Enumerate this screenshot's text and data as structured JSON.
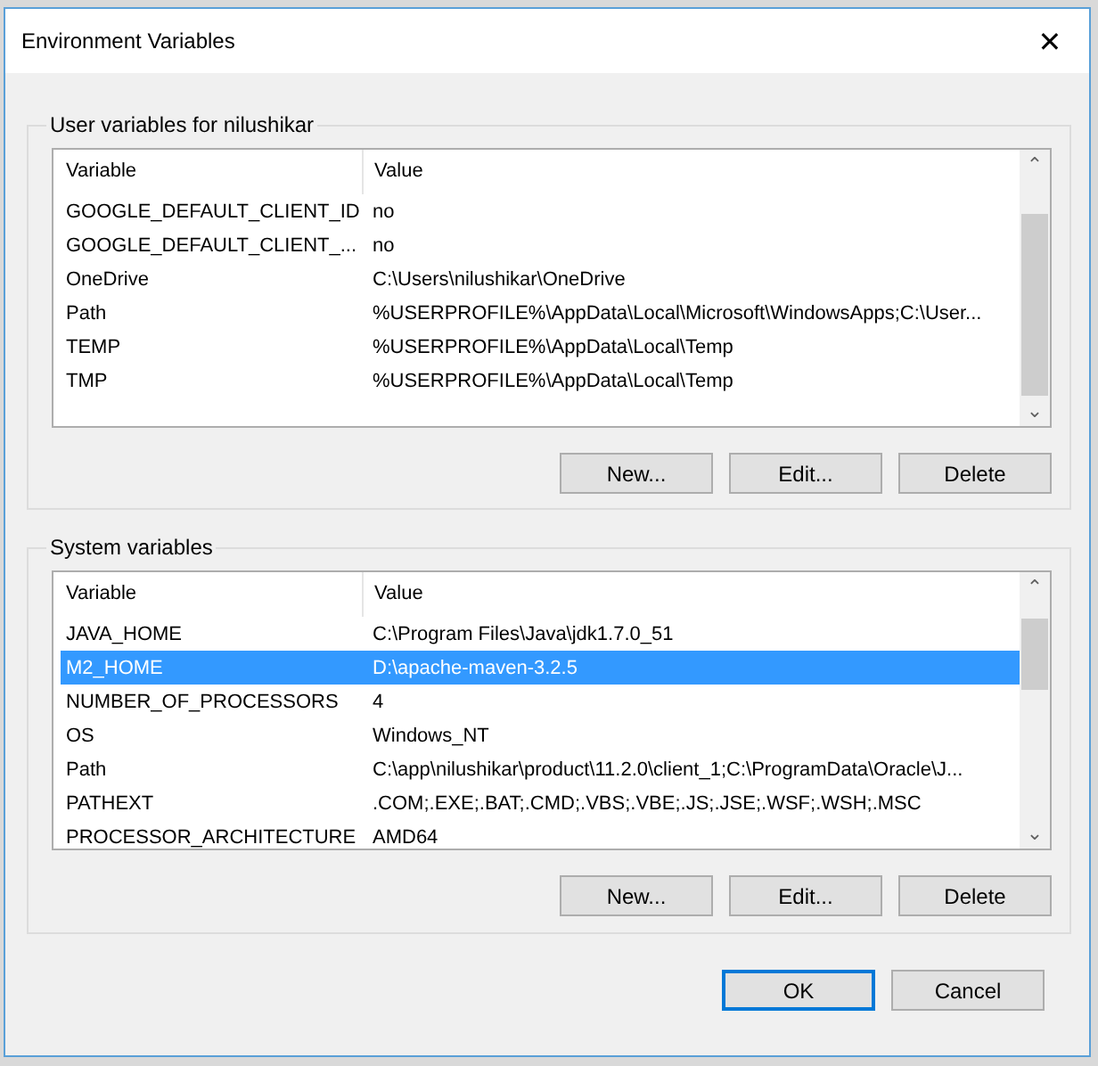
{
  "window": {
    "title": "Environment Variables",
    "close": "✕"
  },
  "groups": [
    {
      "label": "User variables for nilushikar",
      "columns": [
        "Variable",
        "Value"
      ],
      "scroll_up": "⌃",
      "scroll_down": "⌄",
      "rows": [
        {
          "variable": "GOOGLE_DEFAULT_CLIENT_ID",
          "value": "no",
          "selected": false
        },
        {
          "variable": "GOOGLE_DEFAULT_CLIENT_...",
          "value": "no",
          "selected": false
        },
        {
          "variable": "OneDrive",
          "value": "C:\\Users\\nilushikar\\OneDrive",
          "selected": false
        },
        {
          "variable": "Path",
          "value": "%USERPROFILE%\\AppData\\Local\\Microsoft\\WindowsApps;C:\\User...",
          "selected": false
        },
        {
          "variable": "TEMP",
          "value": "%USERPROFILE%\\AppData\\Local\\Temp",
          "selected": false
        },
        {
          "variable": "TMP",
          "value": "%USERPROFILE%\\AppData\\Local\\Temp",
          "selected": false
        }
      ],
      "buttons": [
        "New...",
        "Edit...",
        "Delete"
      ]
    },
    {
      "label": "System variables",
      "columns": [
        "Variable",
        "Value"
      ],
      "scroll_up": "⌃",
      "scroll_down": "⌄",
      "rows": [
        {
          "variable": "JAVA_HOME",
          "value": "C:\\Program Files\\Java\\jdk1.7.0_51",
          "selected": false
        },
        {
          "variable": "M2_HOME",
          "value": "D:\\apache-maven-3.2.5",
          "selected": true
        },
        {
          "variable": "NUMBER_OF_PROCESSORS",
          "value": "4",
          "selected": false
        },
        {
          "variable": "OS",
          "value": "Windows_NT",
          "selected": false
        },
        {
          "variable": "Path",
          "value": "C:\\app\\nilushikar\\product\\11.2.0\\client_1;C:\\ProgramData\\Oracle\\J...",
          "selected": false
        },
        {
          "variable": "PATHEXT",
          "value": ".COM;.EXE;.BAT;.CMD;.VBS;.VBE;.JS;.JSE;.WSF;.WSH;.MSC",
          "selected": false
        },
        {
          "variable": "PROCESSOR_ARCHITECTURE",
          "value": "AMD64",
          "selected": false
        }
      ],
      "buttons": [
        "New...",
        "Edit...",
        "Delete"
      ]
    }
  ],
  "buttons": [
    {
      "label": "OK",
      "default": true
    },
    {
      "label": "Cancel",
      "default": false
    }
  ]
}
